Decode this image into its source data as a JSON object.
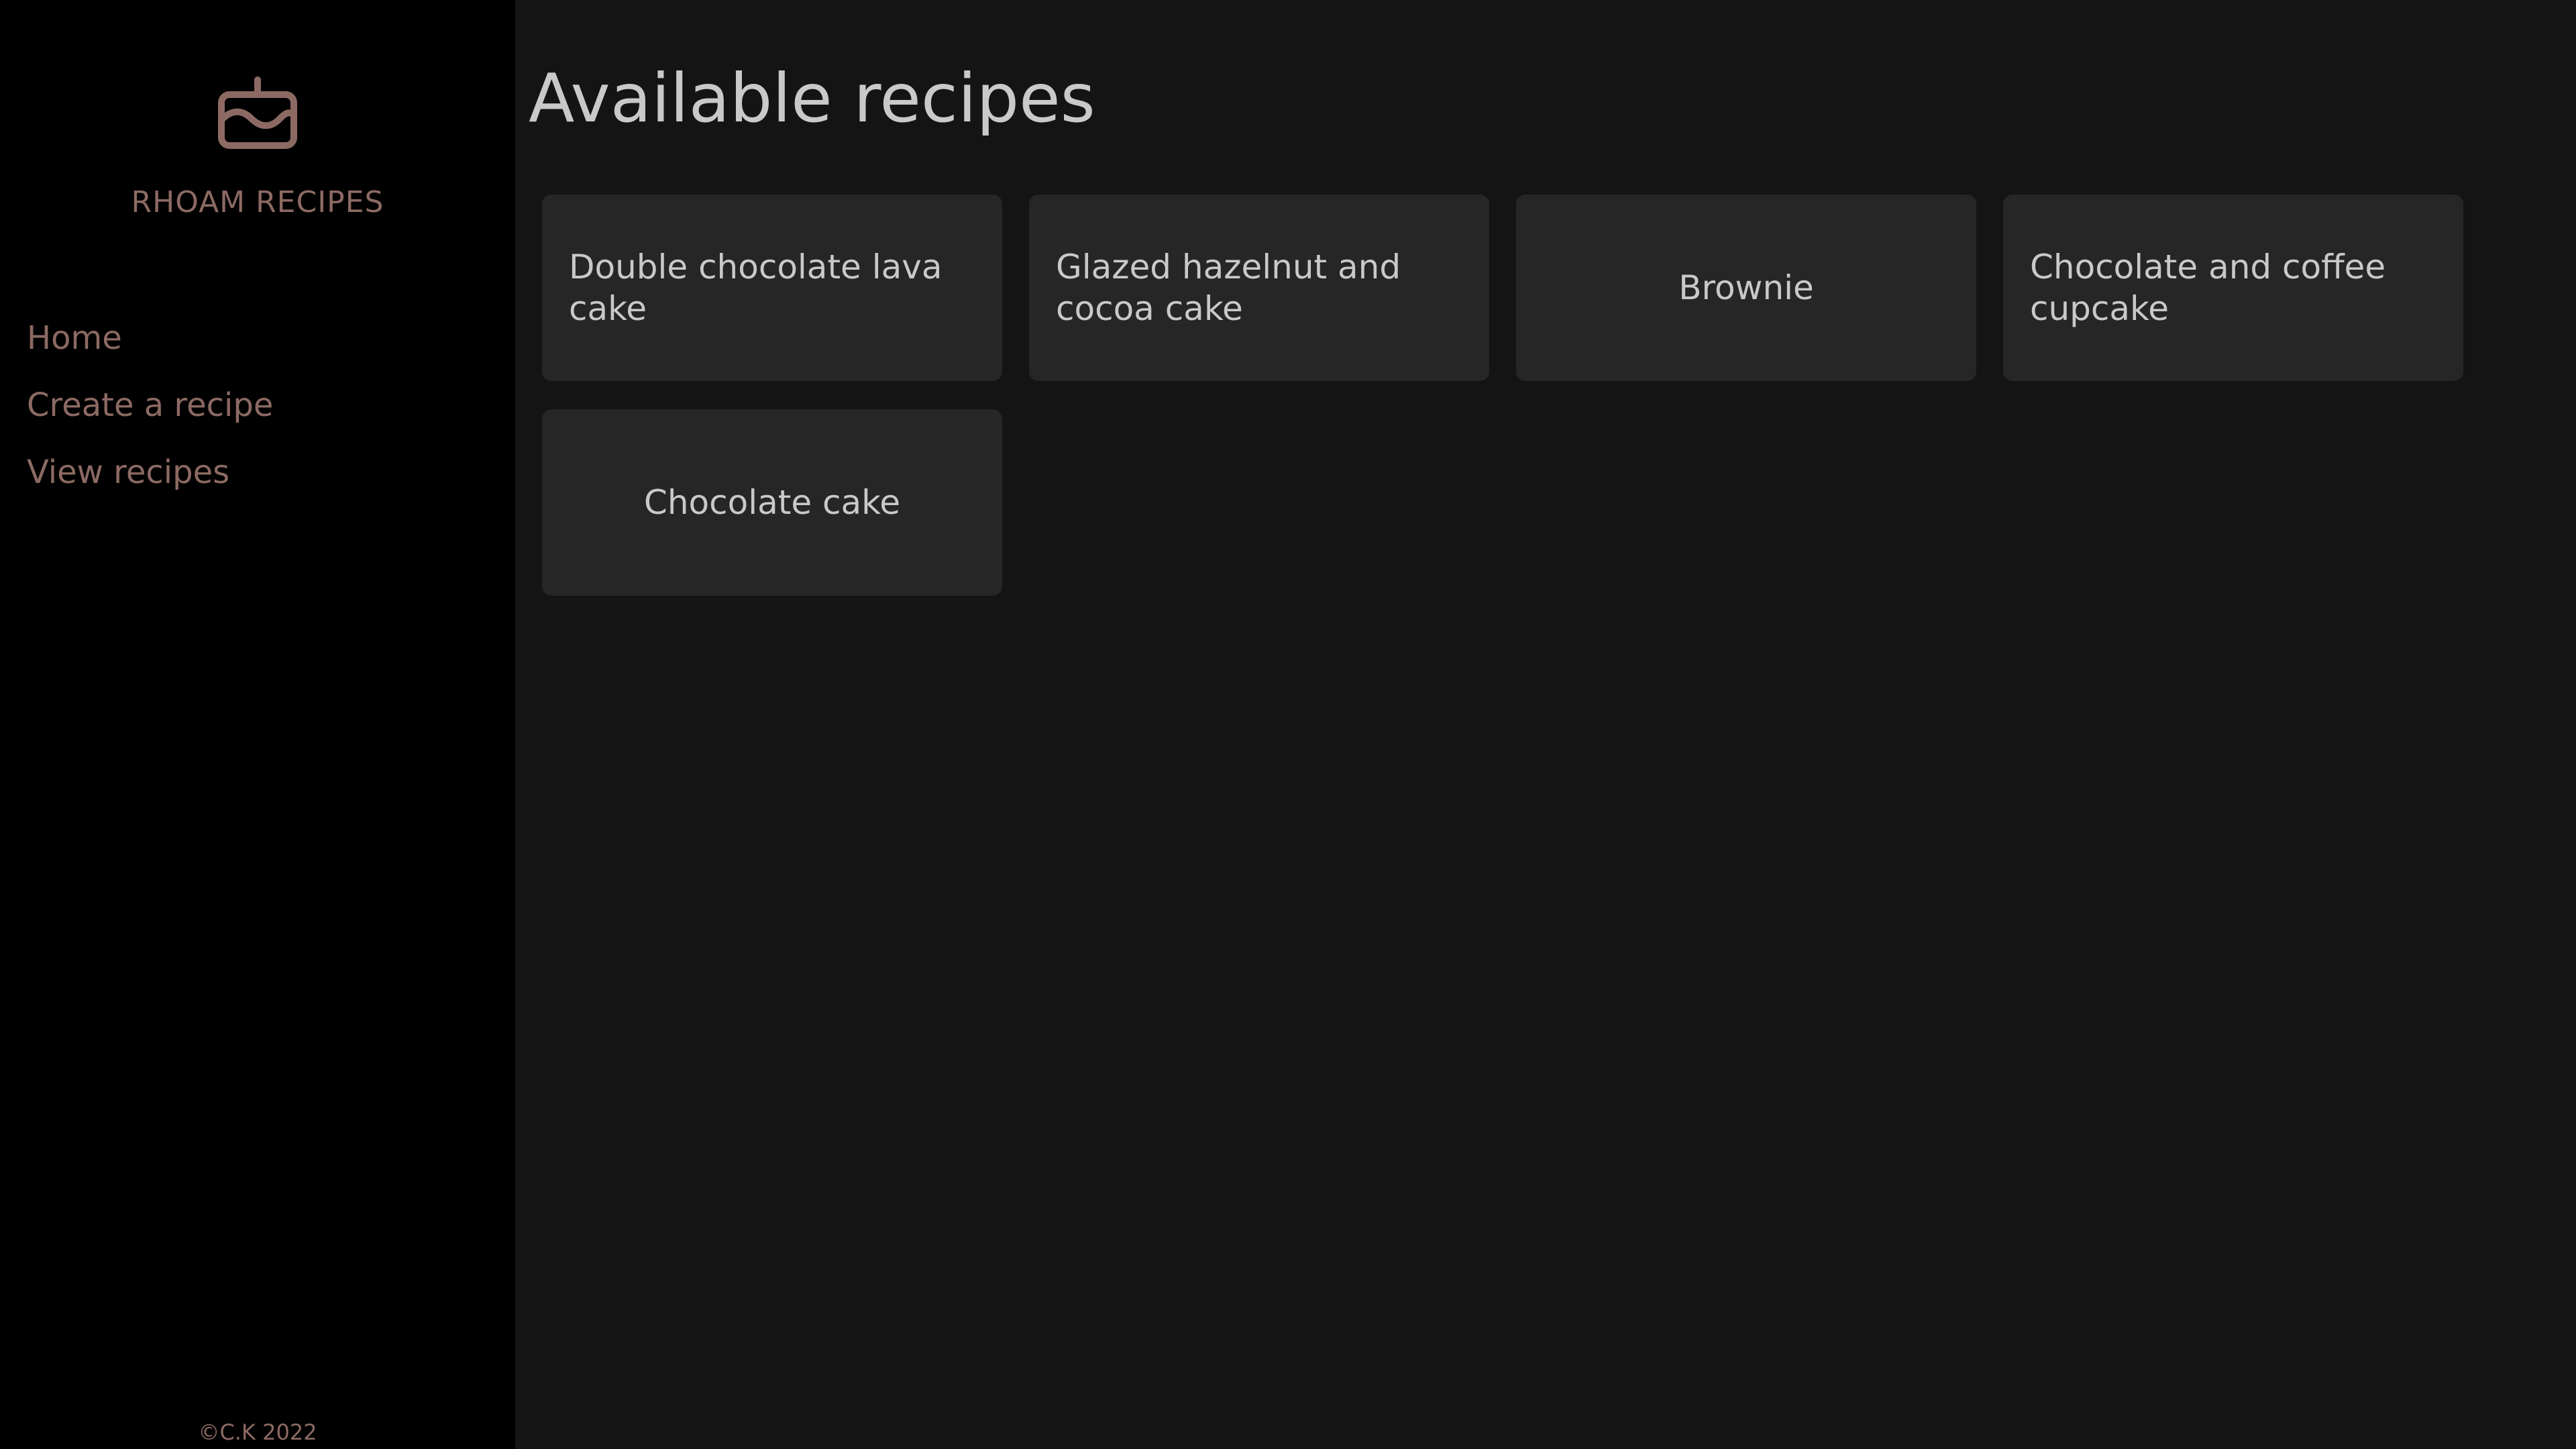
{
  "sidebar": {
    "brand_icon": "cake-icon",
    "brand_name": "RHOAM RECIPES",
    "nav": [
      {
        "label": "Home"
      },
      {
        "label": "Create a recipe"
      },
      {
        "label": "View recipes"
      }
    ],
    "footer": "©C.K 2022"
  },
  "main": {
    "title": "Available recipes",
    "recipes": [
      {
        "title": "Double chocolate lava cake"
      },
      {
        "title": "Glazed hazelnut and cocoa cake"
      },
      {
        "title": "Brownie"
      },
      {
        "title": "Chocolate and coffee cupcake"
      },
      {
        "title": "Chocolate cake"
      }
    ]
  },
  "colors": {
    "sidebar_bg": "#000000",
    "main_bg": "#141414",
    "card_bg": "#262626",
    "accent": "#8c6a63",
    "text": "#c9c9c9"
  }
}
